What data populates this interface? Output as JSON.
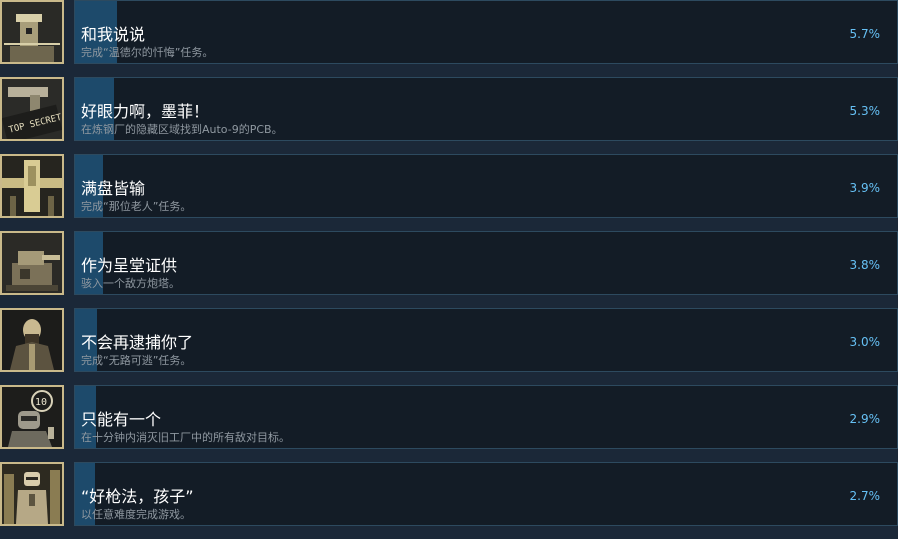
{
  "achievements": [
    {
      "title": "和我说说",
      "description": "完成“温德尔的忏悔”任务。",
      "percent": "5.7%",
      "progress": 0.057,
      "icon": "watchtower-icon"
    },
    {
      "title": "好眼力啊，墨菲！",
      "description": "在炼钢厂的隐藏区域找到Auto-9的PCB。",
      "percent": "5.3%",
      "progress": 0.053,
      "icon": "top-secret-pistol-icon"
    },
    {
      "title": "满盘皆输",
      "description": "完成“那位老人”任务。",
      "percent": "3.9%",
      "progress": 0.039,
      "icon": "banner-icon"
    },
    {
      "title": "作为呈堂证供",
      "description": "骇入一个敌方炮塔。",
      "percent": "3.8%",
      "progress": 0.038,
      "icon": "turret-icon"
    },
    {
      "title": "不会再逮捕你了",
      "description": "完成“无路可逃”任务。",
      "percent": "3.0%",
      "progress": 0.03,
      "icon": "bearded-man-icon"
    },
    {
      "title": "只能有一个",
      "description": "在十分钟内消灭旧工厂中的所有敌对目标。",
      "percent": "2.9%",
      "progress": 0.029,
      "icon": "robot-timer-icon"
    },
    {
      "title": "“好枪法，孩子”",
      "description": "以任意难度完成游戏。",
      "percent": "2.7%",
      "progress": 0.027,
      "icon": "robocop-icon"
    }
  ],
  "icon_badge_text": "10",
  "icon_stamp_text": "TOP SECRET"
}
